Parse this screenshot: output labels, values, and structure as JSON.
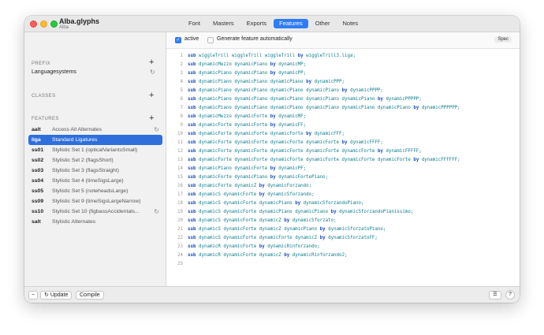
{
  "window": {
    "title": "Alba.glyphs",
    "subtitle": "Alba"
  },
  "tabs": [
    "Font",
    "Masters",
    "Exports",
    "Features",
    "Other",
    "Notes"
  ],
  "active_tab": "Features",
  "sidebar": {
    "prefix_head": "PREFIX",
    "prefix_item": "Languagesystems",
    "classes_head": "CLASSES",
    "features_head": "FEATURES",
    "features": [
      {
        "tag": "aalt",
        "name": "Access All Alternates",
        "refresh": true
      },
      {
        "tag": "liga",
        "name": "Standard Ligatures",
        "selected": true
      },
      {
        "tag": "ss01",
        "name": "Stylistic Set 1 (opticalVariantsSmall)"
      },
      {
        "tag": "ss02",
        "name": "Stylistic Set 2 (flagsShort)"
      },
      {
        "tag": "ss03",
        "name": "Stylistic Set 3 (flagsStraight)"
      },
      {
        "tag": "ss04",
        "name": "Stylistic Set 4 (timeSigsLarge)"
      },
      {
        "tag": "ss05",
        "name": "Stylistic Set 5 (noteheadsLarge)"
      },
      {
        "tag": "ss09",
        "name": "Stylistic Set 9 (timeSigsLargeNarrow)"
      },
      {
        "tag": "ss10",
        "name": "Stylistic Set 10 (figbassAccidentals...",
        "refresh": true
      },
      {
        "tag": "salt",
        "name": "Stylistic Alternates"
      }
    ]
  },
  "options": {
    "active_label": "active",
    "generate_label": "Generate feature automatically",
    "spec_label": "Spec"
  },
  "code_lines": [
    "sub wiggleTrill wiggleTrill wiggleTrill by wiggleTrill3.liga;",
    "sub dynamicMezzo dynamicPiano by dynamicMP;",
    "sub dynamicPiano dynamicPiano by dynamicPP;",
    "sub dynamicPiano dynamicPiano dynamicPiano by dynamicPPP;",
    "sub dynamicPiano dynamicPiano dynamicPiano dynamicPiano by dynamicPPPP;",
    "sub dynamicPiano dynamicPiano dynamicPiano dynamicPiano dynamicPiano by dynamicPPPPP;",
    "sub dynamicPiano dynamicPiano dynamicPiano dynamicPiano dynamicPiano dynamicPiano by dynamicPPPPPP;",
    "sub dynamicMezzo dynamicForte by dynamicMF;",
    "sub dynamicForte dynamicForte by dynamicFF;",
    "sub dynamicForte dynamicForte dynamicForte by dynamicFFF;",
    "sub dynamicForte dynamicForte dynamicForte dynamicForte by dynamicFFFF;",
    "sub dynamicForte dynamicForte dynamicForte dynamicForte dynamicForte by dynamicFFFFF;",
    "sub dynamicForte dynamicForte dynamicForte dynamicForte dynamicForte dynamicForte by dynamicFFFFFF;",
    "sub dynamicPiano dynamicForte by dynamicPF;",
    "sub dynamicForte dynamicPiano by dynamicFortePiano;",
    "sub dynamicForte dynamicZ by dynamicForzando;",
    "sub dynamicS dynamicForte by dynamicSforzando;",
    "sub dynamicS dynamicForte dynamicPiano by dynamicSforzandoPiano;",
    "sub dynamicS dynamicForte dynamicPiano dynamicPiano by dynamicSforzandoPianissimo;",
    "sub dynamicS dynamicForte dynamicZ by dynamicSforzato;",
    "sub dynamicS dynamicForte dynamicZ dynamicPiano by dynamicSforzatoPiano;",
    "sub dynamicS dynamicForte dynamicForte dynamicZ by dynamicSforzatoFF;",
    "sub dynamicR dynamicForte by dynamicRinforzando;",
    "sub dynamicR dynamicForte dynamicZ by dynamicRinforzando2;",
    ""
  ],
  "bottom": {
    "update_label": "Update",
    "compile_label": "Compile",
    "help_label": "?"
  },
  "colors": {
    "accent": "#2f7cf6",
    "selection": "#2f6fdc",
    "keyword": "#1d4fc4",
    "glyph": "#0e7c8c"
  }
}
